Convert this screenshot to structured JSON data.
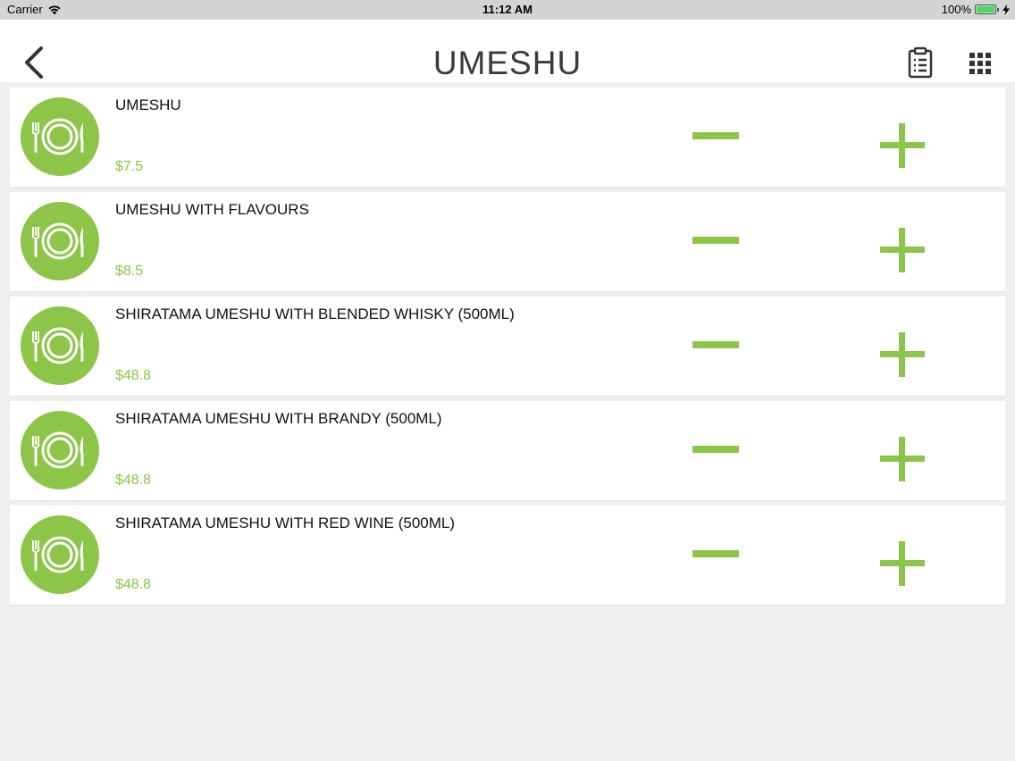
{
  "status_bar": {
    "carrier": "Carrier",
    "time": "11:12 AM",
    "battery": "100%"
  },
  "nav": {
    "title": "UMESHU"
  },
  "colors": {
    "accent": "#8cc548",
    "title": "#3a3a3a",
    "background": "#efefef"
  },
  "icons": {
    "back": "chevron-left-icon",
    "order": "clipboard-icon",
    "menu": "grid-icon",
    "dish": "plate-cutlery-icon",
    "decrease": "minus-icon",
    "increase": "plus-icon"
  },
  "items": [
    {
      "name": "UMESHU",
      "price": "$7.5"
    },
    {
      "name": "UMESHU WITH FLAVOURS",
      "price": "$8.5"
    },
    {
      "name": "SHIRATAMA UMESHU WITH BLENDED WHISKY (500ML)",
      "price": "$48.8"
    },
    {
      "name": "SHIRATAMA UMESHU WITH BRANDY (500ML)",
      "price": "$48.8"
    },
    {
      "name": "SHIRATAMA UMESHU WITH RED WINE (500ML)",
      "price": "$48.8"
    }
  ]
}
